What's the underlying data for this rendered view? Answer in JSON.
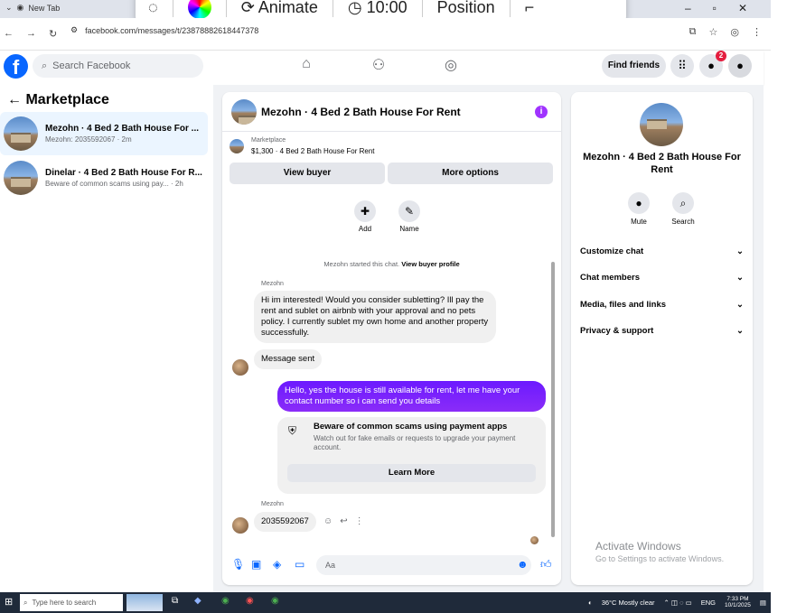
{
  "browser": {
    "tab_title": "New Tab",
    "url": "facebook.com/messages/t/23878882618447378"
  },
  "overlay": {
    "animate": "Animate",
    "time": "10:00",
    "position": "Position"
  },
  "fb": {
    "logo": "f",
    "search_placeholder": "Search Facebook",
    "find_friends": "Find friends",
    "notification_count": "2"
  },
  "left": {
    "title": "Marketplace",
    "conversations": [
      {
        "title": "Mezohn · 4 Bed 2 Bath House For ...",
        "preview": "Mezohn: 2035592067 · 2m"
      },
      {
        "title": "Dinelar · 4 Bed 2 Bath House For R...",
        "preview": "Beware of common scams using pay... · 2h"
      }
    ]
  },
  "chat": {
    "title": "Mezohn · 4 Bed 2 Bath House For Rent",
    "marketplace_label": "Marketplace",
    "listing": "$1,300 · 4 Bed 2 Bath House For Rent",
    "view_buyer": "View buyer",
    "more_options": "More options",
    "add_label": "Add",
    "name_label": "Name",
    "started_text": "Mezohn started this chat.",
    "view_profile": "View buyer profile",
    "sender1": "Mezohn",
    "msg1": "Hi im interested! Would you consider subletting? Ill pay the rent and sublet on airbnb with your approval and no pets policy. I currently sublet my own home and another property successfully.",
    "msg2": "Message sent",
    "msg_me": "Hello, yes the house is still available for rent, let me have your contact number so i can send you  details",
    "scam_title": "Beware of common scams using payment apps",
    "scam_desc": "Watch out for fake emails or requests to upgrade your payment account.",
    "learn_more": "Learn More",
    "sender2": "Mezohn",
    "msg3": "2035592067",
    "composer_placeholder": "Aa"
  },
  "right": {
    "name": "Mezohn · 4 Bed 2 Bath House For Rent",
    "mute": "Mute",
    "search": "Search",
    "rows": [
      "Customize chat",
      "Chat members",
      "Media, files and links",
      "Privacy & support"
    ]
  },
  "watermark": {
    "line1": "Activate Windows",
    "line2": "Go to Settings to activate Windows."
  },
  "taskbar": {
    "search": "Type here to search",
    "weather": "36°C  Mostly clear",
    "lang": "ENG",
    "time": "7:33 PM",
    "date": "10/1/2025"
  }
}
